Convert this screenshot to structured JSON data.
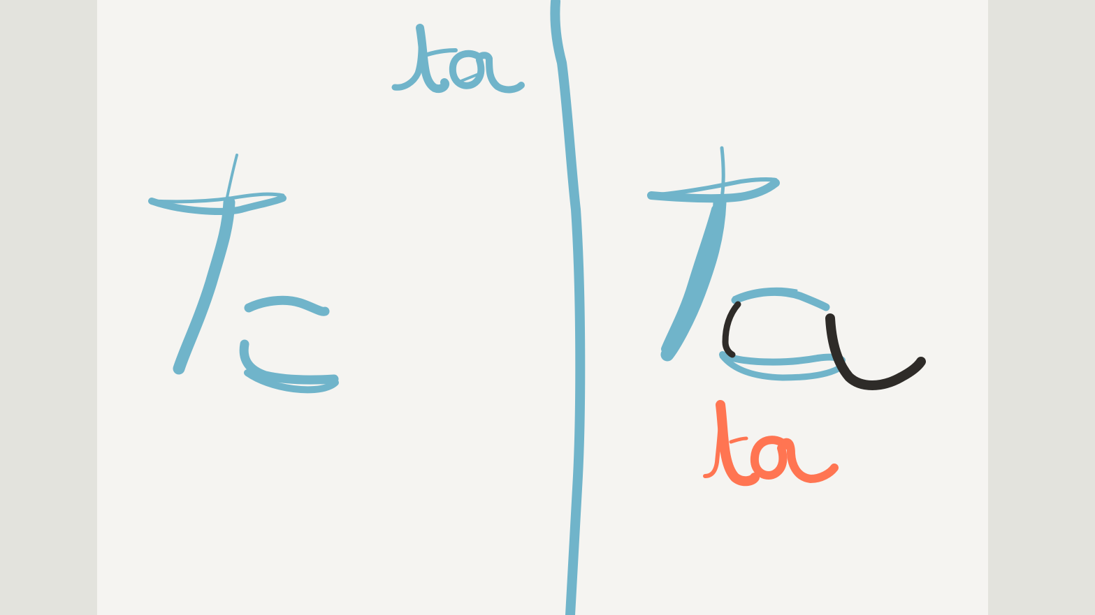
{
  "slide": {
    "top_romaji": "ta",
    "left_glyph": "た",
    "right_glyph": "ta",
    "bottom_romaji": "ta"
  },
  "colors": {
    "frame": "#e3e3dd",
    "paper": "#f5f4f1",
    "blue_ink": "#70b4ca",
    "black_ink": "#2e2b28",
    "orange_ink": "#ff7552"
  }
}
